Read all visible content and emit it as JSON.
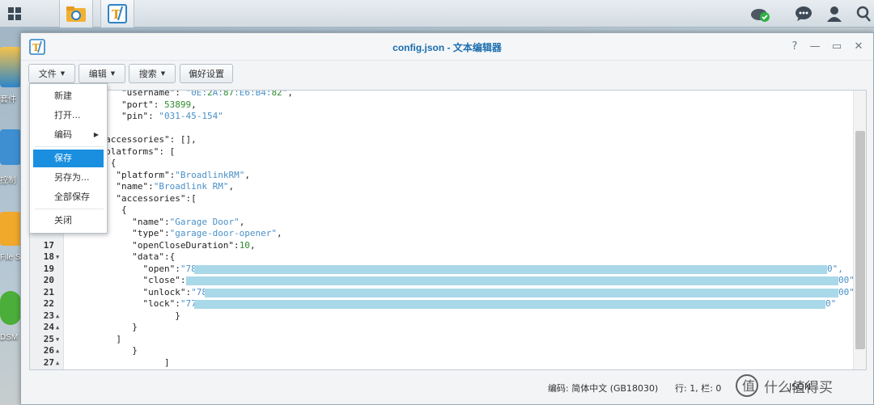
{
  "window": {
    "title": "config.json - 文本编辑器",
    "controls": [
      "?",
      "—",
      "▭",
      "✕"
    ]
  },
  "toolbar": {
    "file_label": "文件",
    "edit_label": "编辑",
    "search_label": "搜索",
    "prefs_label": "偏好设置"
  },
  "file_menu": {
    "items": [
      "新建",
      "打开...",
      "编码",
      "保存",
      "另存为...",
      "全部保存",
      "关闭"
    ],
    "selected": "保存"
  },
  "desktop_labels": [
    "套件",
    "控制",
    "File S",
    "DSM"
  ],
  "editor": {
    "lines": [
      {
        "ln": "",
        "text": "        \"username\": \"0E:2A:87:E6:B4:82\","
      },
      {
        "ln": "",
        "text": "        \"port\": 53899,"
      },
      {
        "ln": "",
        "text": "        \"pin\": \"031-45-154\""
      },
      {
        "ln": "",
        "text": ""
      },
      {
        "ln": "",
        "text": "    \"accessories\": [],"
      },
      {
        "ln": "",
        "text": "    \"platforms\": ["
      },
      {
        "ln": "",
        "text": "      {"
      },
      {
        "ln": "",
        "text": "       \"platform\":\"BroadlinkRM\","
      },
      {
        "ln": "",
        "text": "       \"name\":\"Broadlink RM\","
      },
      {
        "ln": "",
        "text": "       \"accessories\":["
      },
      {
        "ln": "",
        "text": "        {"
      },
      {
        "ln": "",
        "text": "          \"name\":\"Garage Door\","
      },
      {
        "ln": "",
        "text": "          \"type\":\"garage-door-opener\","
      },
      {
        "ln": "17",
        "text": "          \"openCloseDuration\":10,"
      },
      {
        "ln": "18",
        "text": "          \"data\":{"
      },
      {
        "ln": "19",
        "text": "            \"open\":\"7838"
      },
      {
        "ln": "20",
        "text": "            \"close\":\"7"
      },
      {
        "ln": "21",
        "text": "            \"unlock\":\"782d3"
      },
      {
        "ln": "22",
        "text": "            \"lock\":\"7729"
      },
      {
        "ln": "23",
        "text": "                  }"
      },
      {
        "ln": "24",
        "text": "          }"
      },
      {
        "ln": "25",
        "text": "       ]"
      },
      {
        "ln": "26",
        "text": "          }"
      },
      {
        "ln": "27",
        "text": "                ]"
      }
    ],
    "line_tails": [
      "0\",",
      "00\",",
      "00\",",
      "0\""
    ]
  },
  "statusbar": {
    "encoding": "编码: 简体中文 (GB18030)",
    "position": "行: 1, 栏: 0",
    "mode": "JSON"
  },
  "watermark": "什么值得买",
  "colors": {
    "accent": "#1a8fe0",
    "title": "#1a6eb0",
    "string": "#4a90c8",
    "number": "#2e8b2e",
    "redaction": "#a9d8e8"
  }
}
